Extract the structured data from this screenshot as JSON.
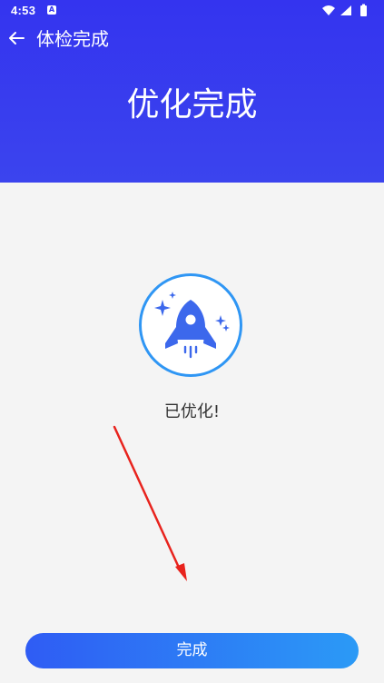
{
  "status_bar": {
    "time": "4:53",
    "notification_icon": "a-icon"
  },
  "toolbar": {
    "title": "体检完成",
    "back_icon": "back-arrow-icon"
  },
  "hero": {
    "title": "优化完成"
  },
  "result": {
    "icon": "rocket-icon",
    "message": "已优化!"
  },
  "annotation": {
    "icon": "red-arrow-icon"
  },
  "footer": {
    "done_label": "完成"
  },
  "colors": {
    "header_blue": "#3434ef",
    "accent_blue": "#2f96f4",
    "rocket_blue": "#3c68ec",
    "button_start": "#2f5cf4",
    "button_end": "#2b9af6",
    "arrow_red": "#e8231d"
  }
}
